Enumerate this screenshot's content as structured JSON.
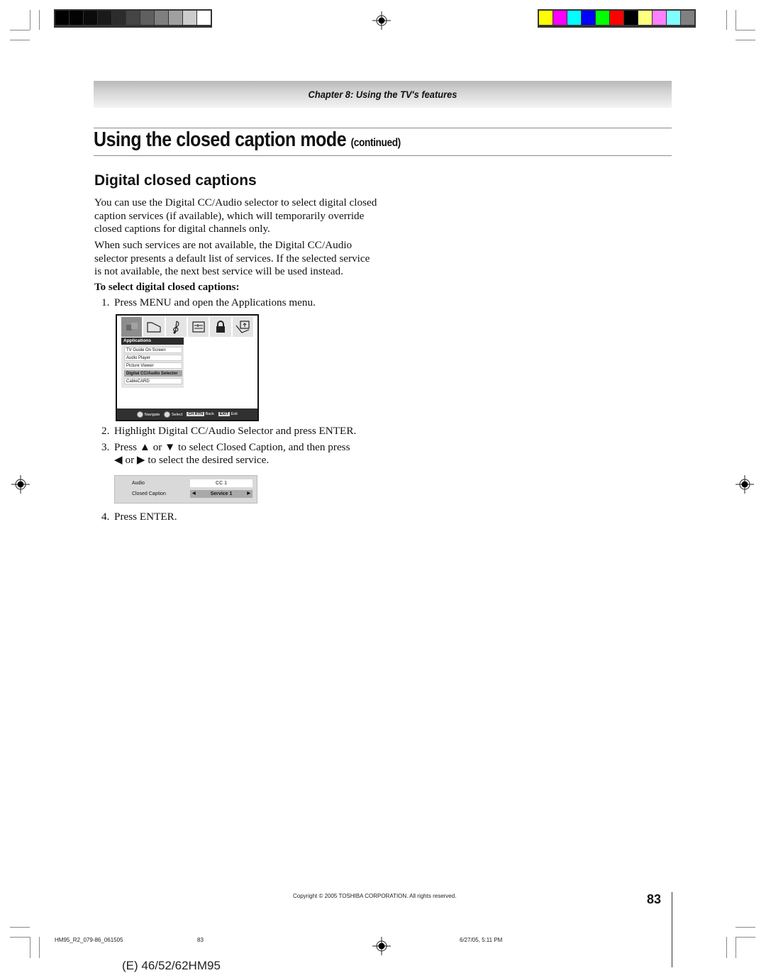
{
  "color_bars": {
    "grayscale": [
      "#000000",
      "#030303",
      "#0b0b0b",
      "#1a1a1a",
      "#2c2c2c",
      "#444444",
      "#5f5f5f",
      "#7f7f7f",
      "#a0a0a0",
      "#cccccc",
      "#ffffff"
    ],
    "colors": [
      "#ffff00",
      "#ff00ff",
      "#00ffff",
      "#0000ff",
      "#00ff00",
      "#ff0000",
      "#000000",
      "#ffff80",
      "#ff80ff",
      "#80ffff",
      "#808080"
    ]
  },
  "header": {
    "chapter": "Chapter 8: Using the TV's features"
  },
  "title": {
    "main": "Using the closed caption mode",
    "suffix": "(continued)"
  },
  "section": {
    "heading": "Digital closed captions",
    "paragraphs": [
      "You can use the Digital CC/Audio selector to select digital closed caption services (if available), which will temporarily override closed captions for digital channels only.",
      "When such services are not available, the Digital CC/Audio selector presents a default list of services. If the selected service is not available, the next best service will be used instead."
    ],
    "subheading": "To select digital closed captions:",
    "steps": [
      {
        "num": "1.",
        "text": "Press MENU and open the Applications menu."
      },
      {
        "num": "2.",
        "text": "Highlight Digital CC/Audio Selector and press ENTER."
      },
      {
        "num": "3.",
        "text": "Press ▲ or ▼ to select Closed Caption, and then press"
      },
      {
        "num": "",
        "text": "◀ or ▶ to select the desired service."
      },
      {
        "num": "4.",
        "text": "Press ENTER."
      }
    ]
  },
  "menu_screen": {
    "icons": [
      "applications-icon",
      "picture-icon",
      "audio-icon",
      "setup-icon",
      "lock-icon",
      "preferences-icon"
    ],
    "panel_title": "Applications",
    "items": [
      "TV Guide On Screen",
      "Audio Player",
      "Picture Viewer",
      "Digital CC/Audio Selector",
      "CableCARD"
    ],
    "selected_index": 3,
    "footer": {
      "navigate": "Navigate",
      "select": "Select",
      "back_key": "CH RTN",
      "back": "Back",
      "exit_key": "EXIT",
      "exit": "Exit"
    }
  },
  "cc_selector": {
    "rows": [
      {
        "label": "Audio",
        "value": "CC 1"
      },
      {
        "label": "Closed Caption",
        "value": "Service 1"
      }
    ],
    "left_arrow": "◀",
    "right_arrow": "▶"
  },
  "footer": {
    "copyright": "Copyright © 2005 TOSHIBA CORPORATION. All rights reserved.",
    "page_number": "83",
    "slug_file": "HM95_R2_079-86_061505",
    "slug_page": "83",
    "slug_date": "6/27/05, 5:11 PM",
    "model": "(E) 46/52/62HM95"
  }
}
